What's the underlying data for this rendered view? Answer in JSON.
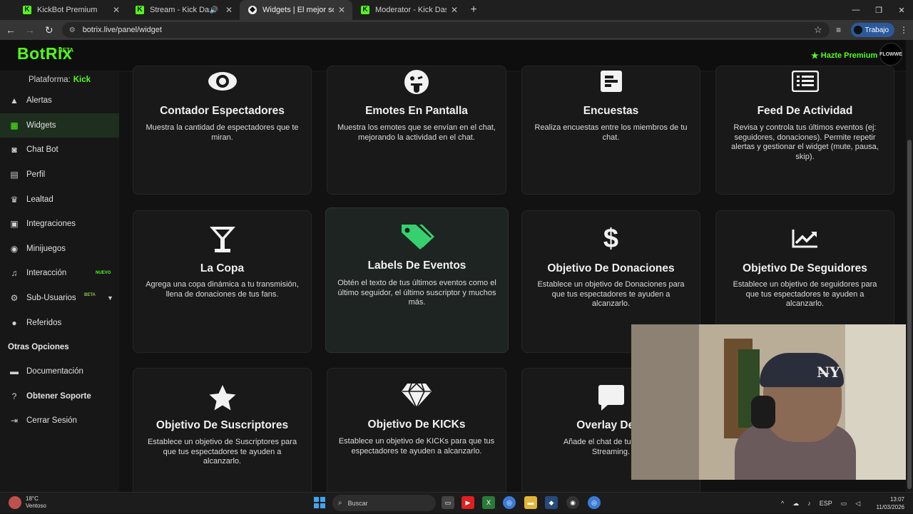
{
  "browser": {
    "tabs": [
      {
        "title": "KickBot Premium",
        "favicon": "kick"
      },
      {
        "title": "Stream - Kick Dashboard",
        "favicon": "kick"
      },
      {
        "title": "Widgets | El mejor software pa",
        "favicon": "botrix"
      },
      {
        "title": "Moderator - Kick Dashboard",
        "favicon": "kick"
      }
    ],
    "url": "botrix.live/panel/widget",
    "profile_label": "Trabajo"
  },
  "header": {
    "brand": "BotRix",
    "beta": "BETA",
    "premium": "Hazte Premium",
    "avatar_text": "FLOWWE",
    "accent": "#53fc18"
  },
  "sidebar": {
    "platform_label": "Plataforma:",
    "platform_value": "Kick",
    "items": [
      {
        "label": "Alertas",
        "icon": "warning-icon"
      },
      {
        "label": "Widgets",
        "icon": "grid-icon"
      },
      {
        "label": "Chat Bot",
        "icon": "robot-icon"
      },
      {
        "label": "Perfil",
        "icon": "id-card-icon"
      },
      {
        "label": "Lealtad",
        "icon": "trophy-icon"
      },
      {
        "label": "Integraciones",
        "icon": "plug-icon"
      },
      {
        "label": "Minijuegos",
        "icon": "gamepad-icon"
      },
      {
        "label": "Interacción",
        "icon": "music-icon",
        "tag": "NUEVO"
      },
      {
        "label": "Sub-Usuarios",
        "icon": "users-cog-icon",
        "tag": "BETA"
      },
      {
        "label": "Referidos",
        "icon": "users-icon"
      }
    ],
    "other_title": "Otras Opciones",
    "other_items": [
      {
        "label": "Documentación",
        "icon": "document-icon"
      },
      {
        "label": "Obtener Soporte",
        "icon": "help-icon"
      },
      {
        "label": "Cerrar Sesión",
        "icon": "logout-icon"
      }
    ]
  },
  "cards": [
    {
      "title": "Contador Espectadores",
      "desc": "Muestra la cantidad de espectadores que te miran.",
      "icon": "eye-icon"
    },
    {
      "title": "Emotes En Pantalla",
      "desc": "Muestra los emotes que se envían en el chat, mejorando la actividad en el chat.",
      "icon": "tongue-emoji-icon"
    },
    {
      "title": "Encuestas",
      "desc": "Realiza encuestas entre los miembros de tu chat.",
      "icon": "poll-icon"
    },
    {
      "title": "Feed De Actividad",
      "desc": "Revisa y controla tus últimos eventos (ej: seguidores, donaciones). Permite repetir alertas y gestionar el widget (mute, pausa, skip).",
      "icon": "list-icon"
    },
    {
      "title": "La Copa",
      "desc": "Agrega una copa dinámica a tu transmisión, llena de donaciones de tus fans.",
      "icon": "cocktail-icon"
    },
    {
      "title": "Labels De Eventos",
      "desc": "Obtén el texto de tus últimos eventos como el último seguidor, el último suscriptor y muchos más.",
      "icon": "tags-icon"
    },
    {
      "title": "Objetivo De Donaciones",
      "desc": "Establece un objetivo de Donaciones para que tus espectadores te ayuden a alcanzarlo.",
      "icon": "dollar-icon"
    },
    {
      "title": "Objetivo De Seguidores",
      "desc": "Establece un objetivo de seguidores para que tus espectadores te ayuden a alcanzarlo.",
      "icon": "chart-line-icon"
    },
    {
      "title": "Objetivo De Suscriptores",
      "desc": "Establece un objetivo de Suscriptores para que tus espectadores te ayuden a alcanzarlo.",
      "icon": "star-icon"
    },
    {
      "title": "Objetivo De KICKs",
      "desc": "Establece un objetivo de KICKs para que tus espectadores te ayuden a alcanzarlo.",
      "icon": "diamond-icon"
    },
    {
      "title": "Overlay De C",
      "desc_line1": "Añade el chat de tu canal a",
      "desc_line2": "Streaming.",
      "icon": "chat-bubble-icon"
    }
  ],
  "taskbar": {
    "temp": "18°C",
    "weather": "Ventoso",
    "search": "Buscar",
    "lang": "ESP",
    "time": "13:07",
    "date": "11/03/2026"
  }
}
